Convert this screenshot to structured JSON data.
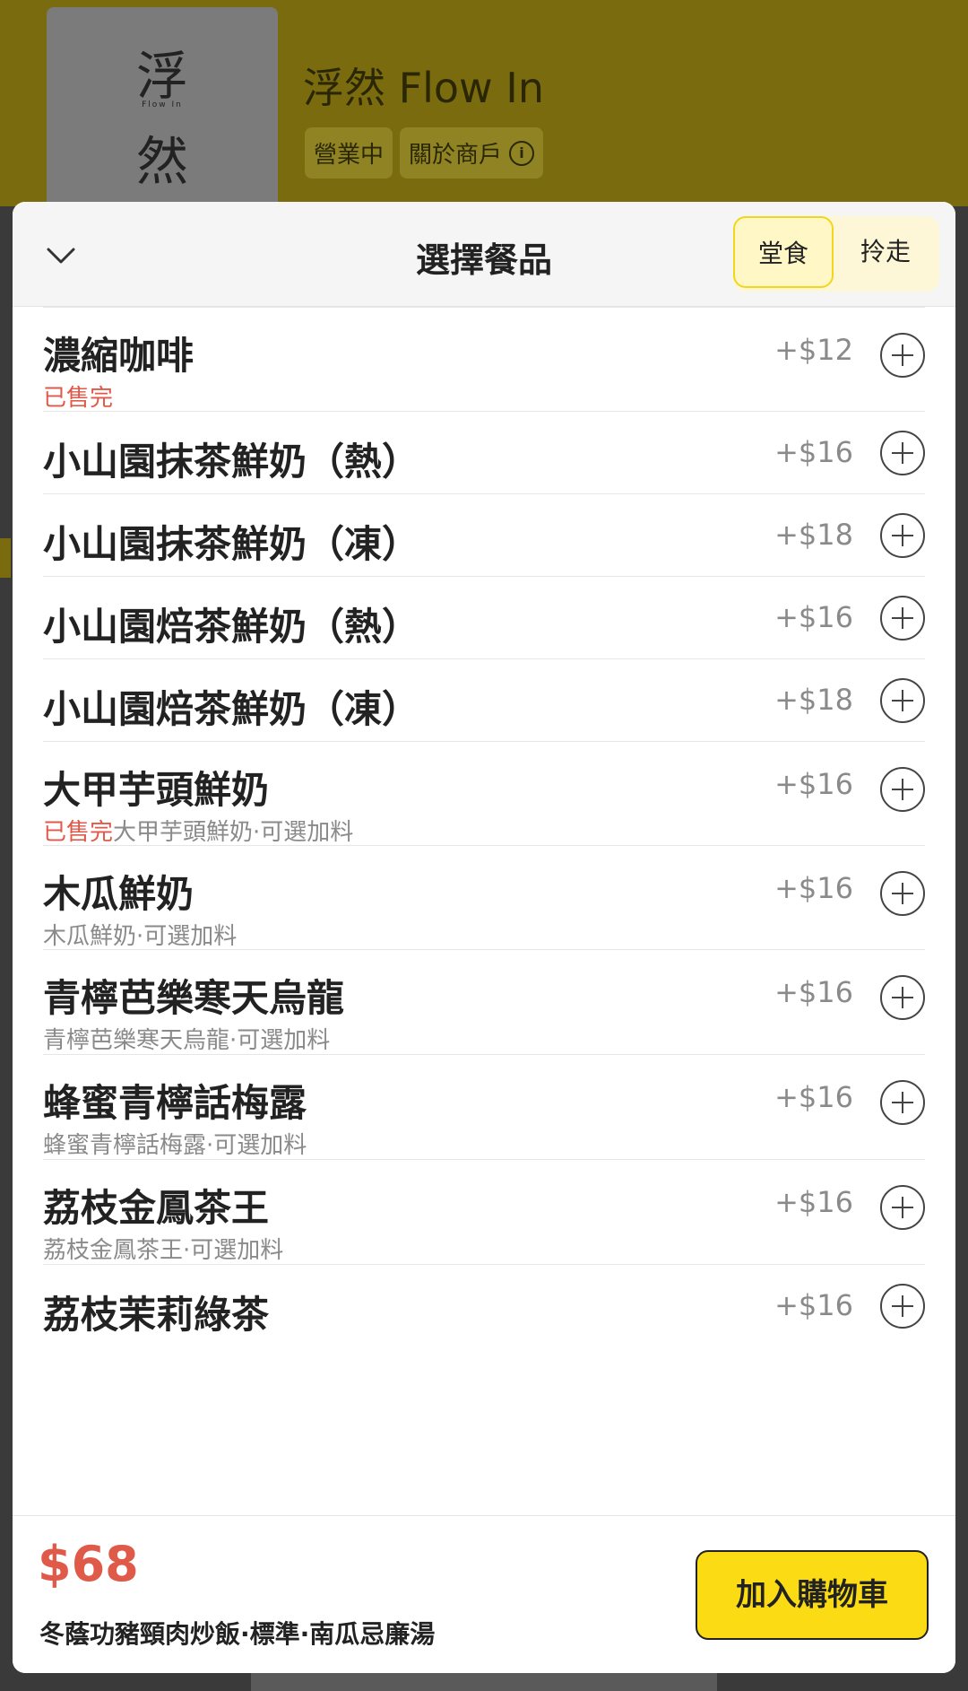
{
  "merchant": {
    "logo_chars": [
      "浮",
      "然"
    ],
    "logo_small": "Flow In",
    "name": "浮然 Flow In",
    "status": "營業中",
    "about": "關於商戶"
  },
  "sheet": {
    "title": "選擇餐品",
    "modes": [
      "堂食",
      "拎走"
    ],
    "active_mode": "堂食"
  },
  "items": [
    {
      "name": "濃縮咖啡",
      "sold_out": "已售完",
      "desc": "",
      "price": "+$12"
    },
    {
      "name": "小山園抹茶鮮奶（熱）",
      "sold_out": "",
      "desc": "",
      "price": "+$16"
    },
    {
      "name": "小山園抹茶鮮奶（凍）",
      "sold_out": "",
      "desc": "",
      "price": "+$18"
    },
    {
      "name": "小山園焙茶鮮奶（熱）",
      "sold_out": "",
      "desc": "",
      "price": "+$16"
    },
    {
      "name": "小山園焙茶鮮奶（凍）",
      "sold_out": "",
      "desc": "",
      "price": "+$18"
    },
    {
      "name": "大甲芋頭鮮奶",
      "sold_out": "已售完",
      "desc": "大甲芋頭鮮奶·可選加料",
      "price": "+$16"
    },
    {
      "name": "木瓜鮮奶",
      "sold_out": "",
      "desc": "木瓜鮮奶·可選加料",
      "price": "+$16"
    },
    {
      "name": "青檸芭樂寒天烏龍",
      "sold_out": "",
      "desc": "青檸芭樂寒天烏龍·可選加料",
      "price": "+$16"
    },
    {
      "name": "蜂蜜青檸話梅露",
      "sold_out": "",
      "desc": "蜂蜜青檸話梅露·可選加料",
      "price": "+$16"
    },
    {
      "name": "荔枝金鳳茶王",
      "sold_out": "",
      "desc": "荔枝金鳳茶王·可選加料",
      "price": "+$16"
    },
    {
      "name": "荔枝茉莉綠茶",
      "sold_out": "",
      "desc": "",
      "price": "+$16"
    }
  ],
  "footer": {
    "total": "$68",
    "summary": "冬蔭功豬頸肉炒飯·標準·南瓜忌廉湯",
    "cart_label": "加入購物車"
  },
  "colors": {
    "brand_yellow": "#fadb14",
    "sold_out_red": "#e05a4a",
    "price_grey": "#8a8a8a"
  }
}
